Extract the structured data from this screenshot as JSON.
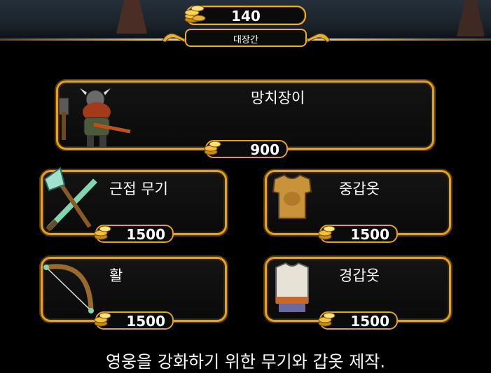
{
  "header": {
    "gold": "140",
    "shop_title": "대장간"
  },
  "hero": {
    "name": "망치장이",
    "price": "900"
  },
  "items": [
    {
      "name": "근접 무기",
      "price": "1500"
    },
    {
      "name": "중갑옷",
      "price": "1500"
    },
    {
      "name": "활",
      "price": "1500"
    },
    {
      "name": "경갑옷",
      "price": "1500"
    }
  ],
  "footer": {
    "description": "영웅을 강화하기 위한 무기와 갑옷 제작."
  },
  "colors": {
    "gold_border": "#e2a420",
    "background": "#000000"
  }
}
